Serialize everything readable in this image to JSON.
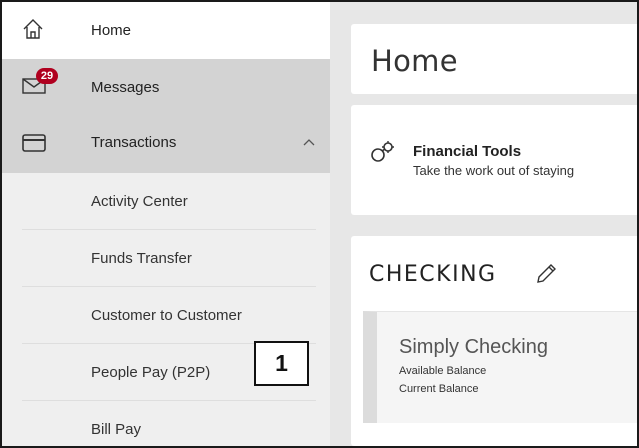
{
  "sidebar": {
    "items": [
      {
        "id": "home",
        "label": "Home",
        "icon": "home-icon"
      },
      {
        "id": "messages",
        "label": "Messages",
        "icon": "envelope-icon",
        "badge": "29"
      },
      {
        "id": "transactions",
        "label": "Transactions",
        "icon": "card-icon",
        "expanded": true
      }
    ],
    "sub_items": [
      {
        "label": "Activity Center"
      },
      {
        "label": "Funds Transfer"
      },
      {
        "label": "Customer to Customer"
      },
      {
        "label": "People Pay (P2P)"
      },
      {
        "label": "Bill Pay"
      }
    ]
  },
  "callout": {
    "label": "1"
  },
  "main": {
    "page_title": "Home",
    "financial_tools": {
      "title": "Financial Tools",
      "description": "Take the work out of staying",
      "icon": "tools-icon"
    },
    "checking": {
      "title": "CHECKING",
      "edit_icon": "pencil-icon",
      "account": {
        "name": "Simply Checking",
        "available_label": "Available Balance",
        "current_label": "Current Balance"
      }
    }
  },
  "colors": {
    "badge": "#b0001f",
    "sidebar_active": "#d3d3d3",
    "main_bg": "#e7e7e7"
  }
}
